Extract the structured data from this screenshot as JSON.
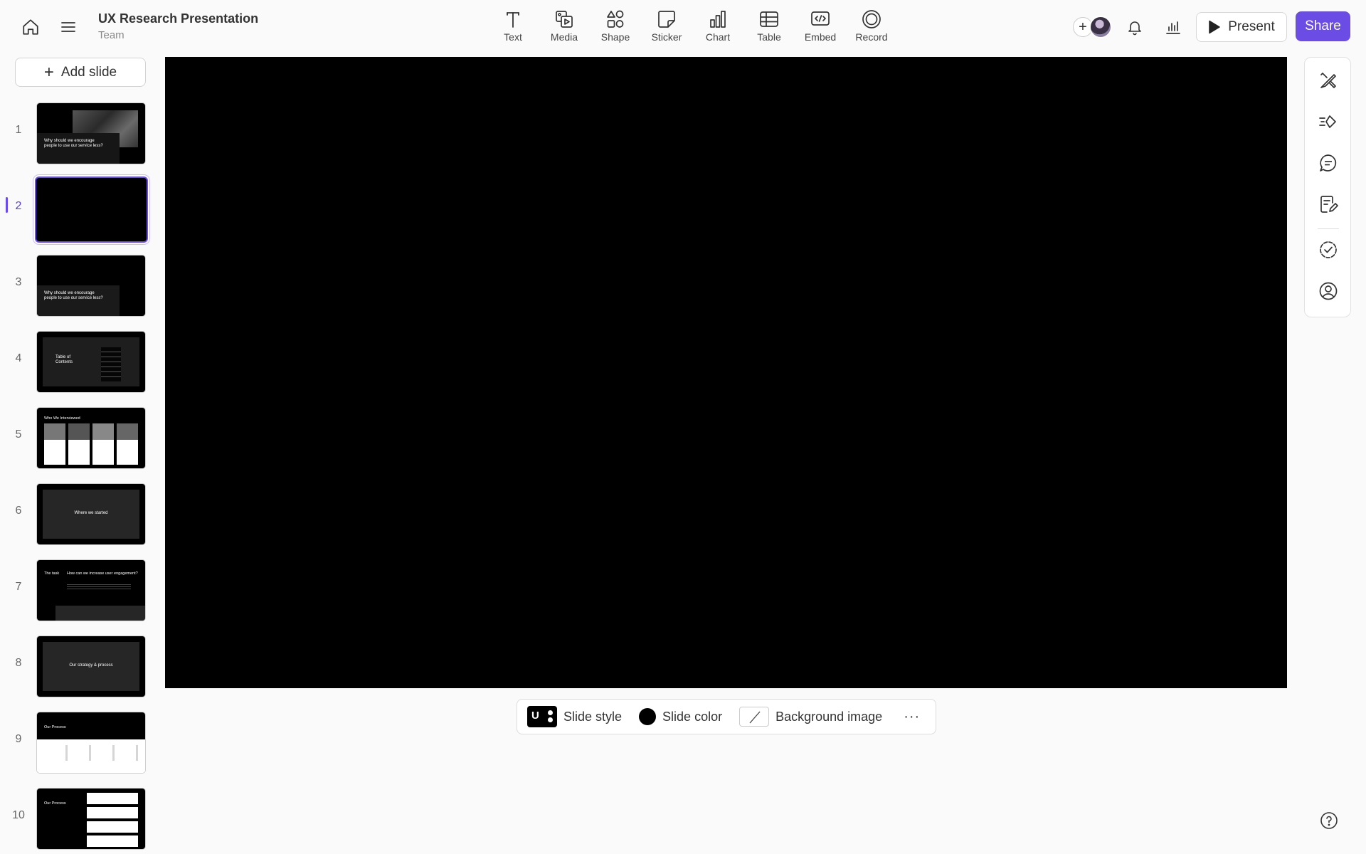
{
  "header": {
    "title": "UX Research Presentation",
    "subtitle": "Team",
    "home_icon": "home-icon",
    "menu_icon": "menu-icon"
  },
  "tools": [
    {
      "label": "Text",
      "icon": "text-icon"
    },
    {
      "label": "Media",
      "icon": "media-icon"
    },
    {
      "label": "Shape",
      "icon": "shape-icon"
    },
    {
      "label": "Sticker",
      "icon": "sticker-icon"
    },
    {
      "label": "Chart",
      "icon": "chart-icon"
    },
    {
      "label": "Table",
      "icon": "table-icon"
    },
    {
      "label": "Embed",
      "icon": "embed-icon"
    },
    {
      "label": "Record",
      "icon": "record-icon"
    }
  ],
  "actions": {
    "present_label": "Present",
    "share_label": "Share"
  },
  "colors": {
    "accent": "#6b4de6",
    "canvas": "#000000",
    "background": "#fafafa"
  },
  "sidebar": {
    "add_slide_label": "Add slide",
    "active_slide": 2,
    "slides": [
      {
        "number": "1",
        "text": [
          "Why should we encourage",
          "people to use our service less?"
        ]
      },
      {
        "number": "2",
        "text": []
      },
      {
        "number": "3",
        "text": [
          "Why should we encourage",
          "people to use our service less?"
        ]
      },
      {
        "number": "4",
        "text": [
          "Table of",
          "Contents"
        ]
      },
      {
        "number": "5",
        "text": [
          "Who We Interviewed"
        ]
      },
      {
        "number": "6",
        "text": [
          "Where we started"
        ]
      },
      {
        "number": "7",
        "text": [
          "The task",
          "How can we increase user engagement?"
        ]
      },
      {
        "number": "8",
        "text": [
          "Our strategy & process"
        ]
      },
      {
        "number": "9",
        "text": [
          "Our Process"
        ]
      },
      {
        "number": "10",
        "text": [
          "Our Process"
        ]
      }
    ]
  },
  "slide_toolbar": {
    "style_label": "Slide style",
    "style_badge": "U",
    "color_label": "Slide color",
    "background_label": "Background image",
    "more_label": "···"
  },
  "right_rail": [
    {
      "name": "design-icon"
    },
    {
      "name": "animate-icon"
    },
    {
      "name": "comment-icon"
    },
    {
      "name": "notes-icon"
    },
    {
      "name": "review-icon"
    },
    {
      "name": "profile-icon"
    }
  ],
  "help_icon": "help-icon"
}
